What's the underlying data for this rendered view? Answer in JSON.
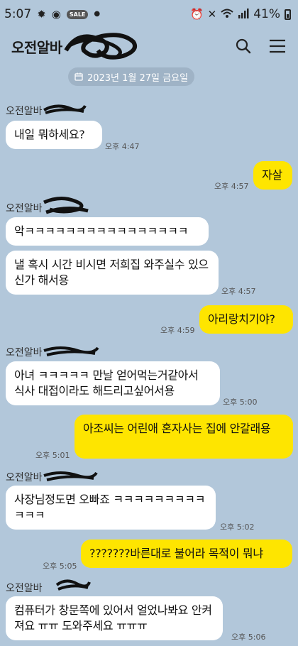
{
  "status_bar": {
    "time": "5:07",
    "battery": "41%"
  },
  "header": {
    "title": "오전알바",
    "search_icon": "search-icon",
    "menu_icon": "menu-icon"
  },
  "date_divider": "2023년 1월 27일 금요일",
  "messages": [
    {
      "side": "them",
      "sender": "오전알바",
      "text": "내일 뭐하세요?",
      "time": "오후 4:47"
    },
    {
      "side": "me",
      "text": "자살",
      "time": "오후 4:57"
    },
    {
      "side": "them",
      "sender": "오전알바",
      "text": "악ㅋㅋㅋㅋㅋㅋㅋㅋㅋㅋㅋㅋㅋㅋㅋㅋ",
      "time": ""
    },
    {
      "side": "them",
      "text": "낼 혹시 시간 비시면 저희집 와주실수 있으신가 해서용",
      "time": "오후 4:57"
    },
    {
      "side": "me",
      "text": "아리랑치기야?",
      "time": "오후 4:59"
    },
    {
      "side": "them",
      "sender": "오전알바",
      "text": "아녀 ㅋㅋㅋㅋㅋ 만날 얻어먹는거같아서 식사 대접이라도 해드리고싶어서용",
      "time": "오후 5:00"
    },
    {
      "side": "me",
      "text": "아조씨는 어린애 혼자사는 집에 안갈래용",
      "time": "오후 5:01"
    },
    {
      "side": "them",
      "sender": "오전알바",
      "text": "사장님정도면 오빠죠 ㅋㅋㅋㅋㅋㅋㅋㅋㅋㅋㅋㅋ",
      "time": "오후 5:02"
    },
    {
      "side": "me",
      "text": "???????바른대로 불어라 목적이 뭐냐",
      "time": "오후 5:05"
    },
    {
      "side": "them",
      "sender": "오전알바",
      "text": "컴퓨터가 창문쪽에 있어서 얼었나봐요 안켜져요 ㅠㅠ 도와주세요 ㅠㅠㅠ",
      "time": "오후 5:06"
    }
  ],
  "colors": {
    "background": "#b2c7da",
    "my_bubble": "#fee500",
    "their_bubble": "#ffffff"
  }
}
